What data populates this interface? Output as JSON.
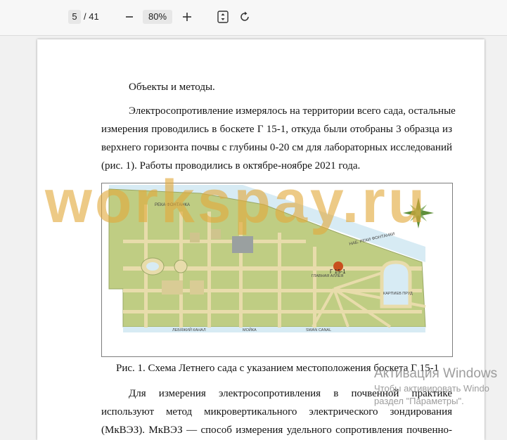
{
  "toolbar": {
    "page_current": "5",
    "page_total": "/ 41",
    "zoom": "80%",
    "zoom_out_icon": "minus-icon",
    "zoom_in_icon": "plus-icon",
    "fit_icon": "fit-page-icon",
    "rotate_icon": "rotate-icon"
  },
  "document": {
    "heading": "Объекты и методы.",
    "para1": [
      "Электросопротивление измерялось на территории всего сада, остальные",
      "измерения проводились в боскете Г 15-1, откуда были отобраны 3 образца из",
      "верхнего горизонта почвы с глубины 0-20 см для лабораторных исследований",
      "(рис. 1). Работы проводились в октябре-ноябре 2021 года."
    ],
    "caption": "Рис. 1. Схема Летнего сада с указанием местоположения боскета Г 15-1",
    "para2": [
      "Для измерения электросопротивления в почвенной практике",
      "используют метод микровертикального электрического зондирования",
      "(МкВЭЗ). МкВЭЗ — способ измерения удельного сопротивления почвенно-"
    ]
  },
  "map": {
    "label_fontanka": "РЕКА ФОНТАНКА",
    "label_fontanka2": "НАБ. РЕКИ ФОНТАНКИ",
    "label_alley": "ГЛАВНАЯ АЛЛЕЯ",
    "label_g15": "Г 15-1",
    "label_pond": "КАРПИЕВ ПРУД",
    "label_lebyazhy": "ЛЕБЯЖИЙ КАНАЛ",
    "label_swan": "SWAN CANAL",
    "label_mojka": "МОЙКА",
    "colors": {
      "lawn": "#b8c77b",
      "path": "#e6d9a6",
      "water": "#cfe6f0",
      "marker": "#c8501e",
      "compass": "#5f8f3a"
    }
  },
  "watermark": "workspay.ru",
  "activation": {
    "title": "Активация Windows",
    "line1": "Чтобы активировать Windo",
    "line2": "раздел \"Параметры\"."
  }
}
